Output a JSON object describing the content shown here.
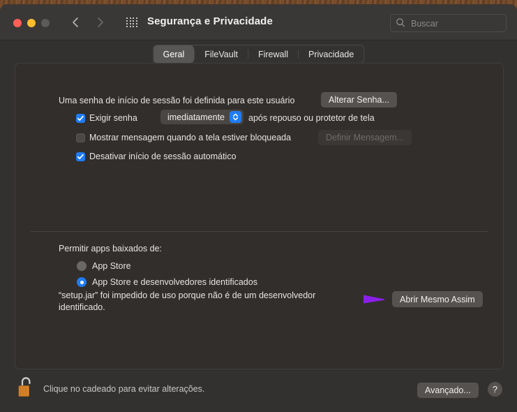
{
  "window": {
    "title": "Segurança e Privacidade",
    "traffic_lights": [
      "close",
      "minimize",
      "zoom"
    ],
    "nav": {
      "back_icon": "chevron-left-icon",
      "forward_icon": "chevron-right-icon"
    },
    "grid_icon": "grid-apps-icon"
  },
  "search": {
    "placeholder": "Buscar",
    "value": "",
    "icon": "search-icon"
  },
  "tabs": [
    {
      "label": "Geral",
      "selected": true
    },
    {
      "label": "FileVault",
      "selected": false
    },
    {
      "label": "Firewall",
      "selected": false
    },
    {
      "label": "Privacidade",
      "selected": false
    }
  ],
  "general": {
    "password_set_text": "Uma senha de início de sessão foi definida para este usuário",
    "change_password_button": "Alterar Senha...",
    "require_password": {
      "label": "Exigir senha",
      "checked": true,
      "delay_value": "imediatamente",
      "suffix": "após repouso ou protetor de tela",
      "stepper_icon": "chevron-up-down-icon"
    },
    "show_message": {
      "label": "Mostrar mensagem quando a tela estiver bloqueada",
      "checked": false,
      "set_message_button": "Definir Mensagem...",
      "set_message_disabled": true
    },
    "disable_auto_login": {
      "label": "Desativar início de sessão automático",
      "checked": true
    }
  },
  "downloads": {
    "heading": "Permitir apps baixados de:",
    "options": [
      {
        "label": "App Store",
        "selected": false
      },
      {
        "label": "App Store e desenvolvedores identificados",
        "selected": true
      }
    ],
    "blocked_message": "“setup.jar” foi impedido de uso porque não é de um desenvolvedor identificado.",
    "open_anyway_button": "Abrir Mesmo Assim",
    "pointer_icon": "arrow-pointer-annotation"
  },
  "bottom": {
    "lock_icon": "unlocked-padlock-icon",
    "lock_text": "Clique no cadeado para evitar alterações.",
    "advanced_button": "Avançado...",
    "help_button": "?"
  },
  "colors": {
    "accent_blue": "#1f7cf2",
    "annotation_purple": "#8a20e8",
    "lock_gold": "#e08a2e",
    "window_bg": "#333130",
    "panel_bg": "#322e2c"
  }
}
